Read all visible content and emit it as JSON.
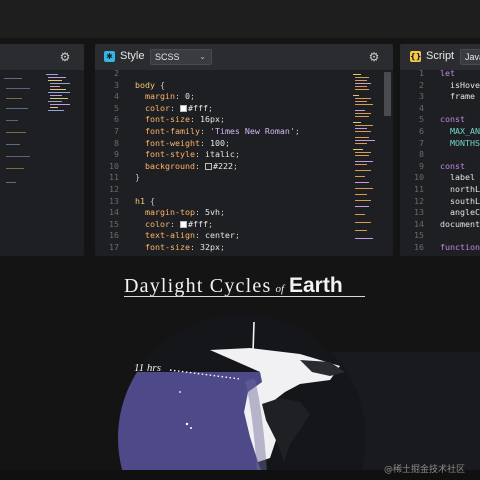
{
  "panels": {
    "style": {
      "title": "Style",
      "preprocessor": "SCSS",
      "line_numbers": "2\n3\n4\n5\n6\n7\n8\n9\n10\n11\n12\n13\n14\n15\n16\n17",
      "accent": "#2fb7e8"
    },
    "script": {
      "title": "Script",
      "preprocessor": "Java",
      "line_numbers": "1\n2\n3\n4\n5\n6\n7\n8\n9\n10\n11\n12\n13\n14\n15\n16",
      "accent": "#f7c948"
    }
  },
  "css_code": {
    "body_sel": "body",
    "margin_prop": "margin",
    "margin_val": "0",
    "color_prop": "color",
    "color_val": "#fff",
    "fs_prop": "font-size",
    "fs_val": "16px",
    "ff_prop": "font-family",
    "ff_val": "'Times New Roman'",
    "fw_prop": "font-weight",
    "fw_val": "100",
    "fst_prop": "font-style",
    "fst_val": "italic",
    "bg_prop": "background",
    "bg_val": "#222",
    "h1_sel": "h1",
    "mt_prop": "margin-top",
    "mt_val": "5vh",
    "h1_color_prop": "color",
    "h1_color_val": "#fff",
    "ta_prop": "text-align",
    "ta_val": "center",
    "h1_fs_prop": "font-size",
    "h1_fs_val": "32px",
    "open_brace": "{",
    "close_brace": "}",
    "colon": ":",
    "semi": ";",
    "swatch_white": "#ffffff",
    "swatch_dark": "#222222"
  },
  "js_code": {
    "l1": "let",
    "l2": "isHover",
    "l3": "frame =",
    "l5": "const",
    "l6": "MAX_ANG",
    "l7": "MONTHS",
    "l9": "const",
    "l10": "label =",
    "l11": "northLa",
    "l12": "southLa",
    "l13": "angleCs",
    "l14": "document.",
    "l16": "function"
  },
  "preview": {
    "title_main": "Daylight Cycles",
    "title_of": "of",
    "title_earth": "Earth",
    "hours_label": "11 hrs",
    "ocean_color": "#4e4a8a",
    "night_color": "#15161a"
  },
  "watermark": "@稀土掘金技术社区"
}
